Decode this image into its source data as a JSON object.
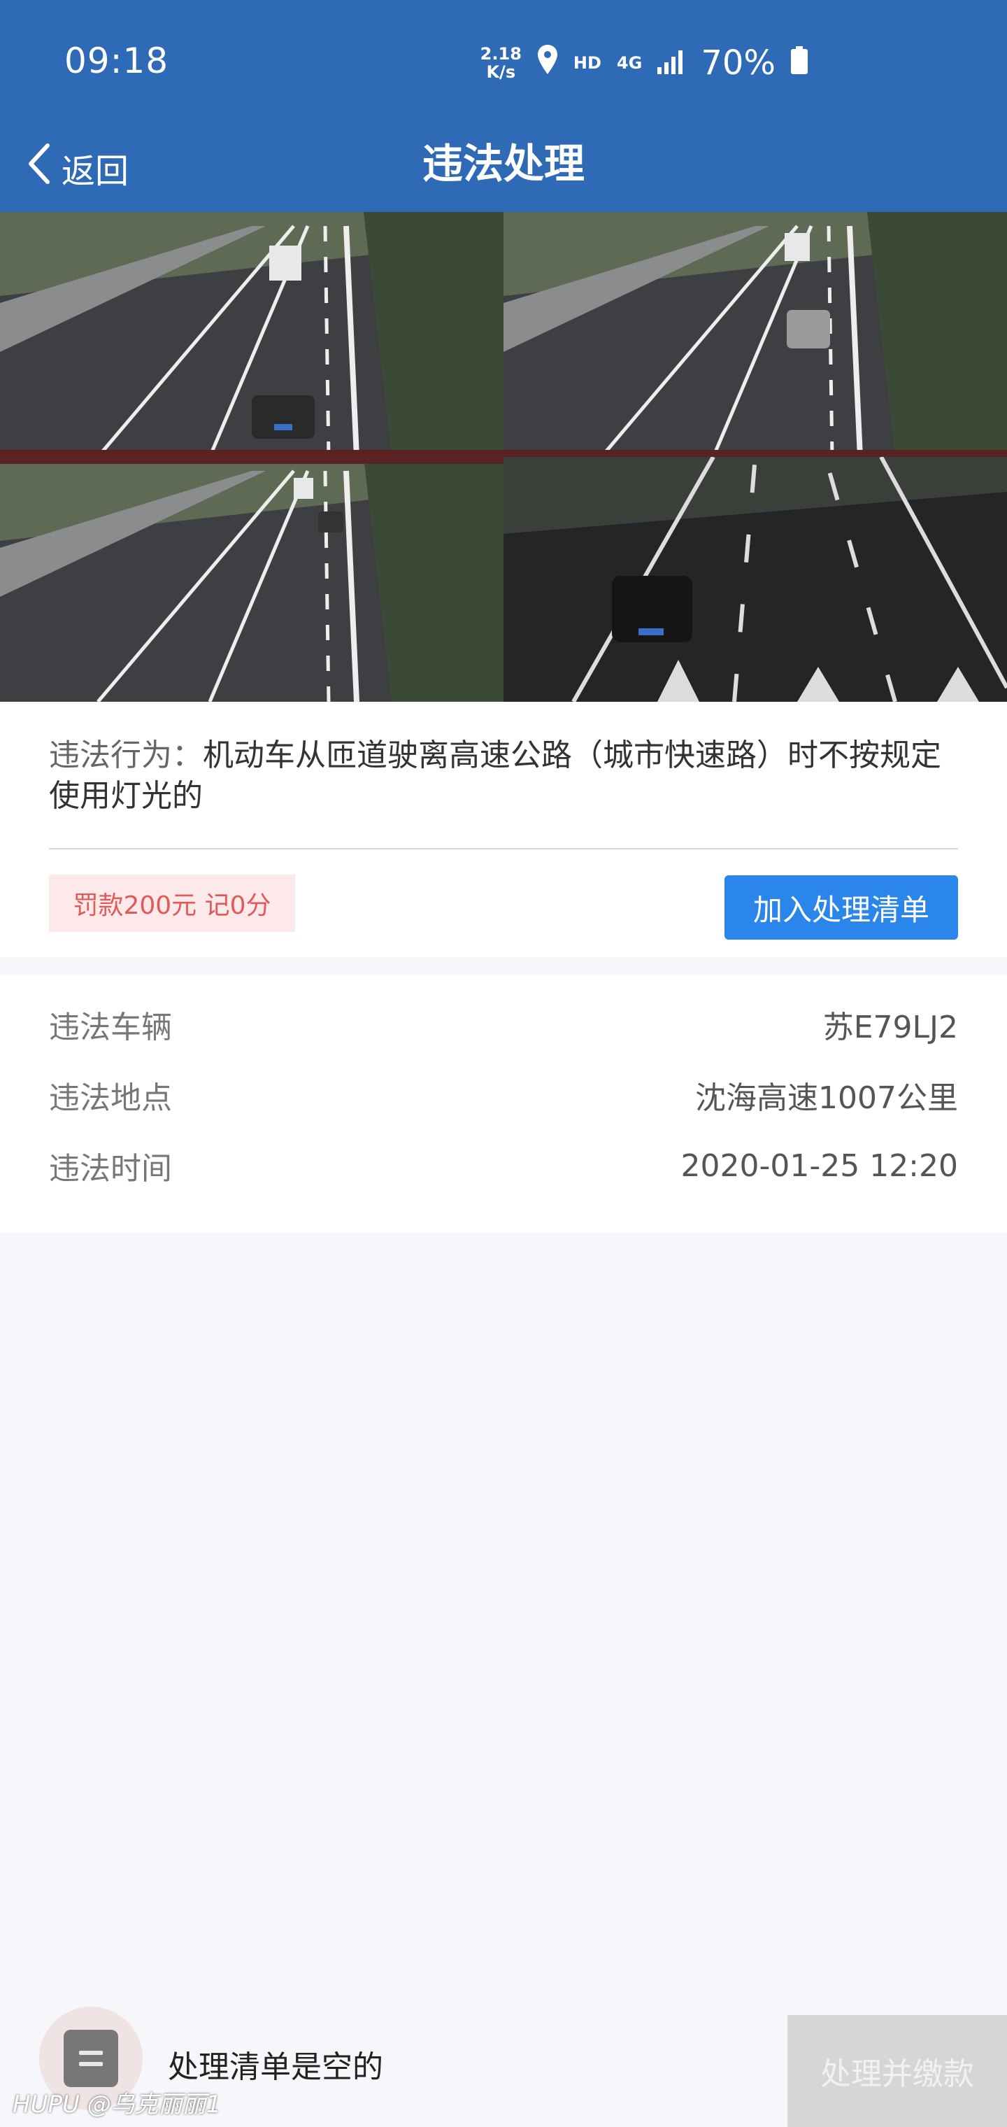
{
  "status_bar": {
    "time": "09:18",
    "net_speed_value": "2.18",
    "net_speed_unit": "K/s",
    "hd": "HD",
    "network": "4G",
    "battery": "70%",
    "icons": [
      "location-icon",
      "signal-icon",
      "battery-icon"
    ]
  },
  "nav": {
    "back_label": "返回",
    "title": "违法处理"
  },
  "photos": [
    {
      "name": "evidence-photo-1"
    },
    {
      "name": "evidence-photo-2"
    },
    {
      "name": "evidence-photo-3"
    },
    {
      "name": "evidence-photo-4"
    }
  ],
  "violation": {
    "behavior_label": "违法行为：",
    "behavior_text": "机动车从匝道驶离高速公路（城市快速路）时不按规定使用灯光的",
    "fine_tag": "罚款200元 记0分",
    "add_button": "加入处理清单"
  },
  "info": {
    "rows": [
      {
        "key": "违法车辆",
        "value": "苏E79LJ2"
      },
      {
        "key": "违法地点",
        "value": "沈海高速1007公里"
      },
      {
        "key": "违法时间",
        "value": "2020-01-25 12:20"
      }
    ]
  },
  "bottom": {
    "empty_text": "处理清单是空的",
    "pay_button": "处理并缴款"
  },
  "watermark": "HUPU @乌克丽丽1",
  "colors": {
    "header_bg": "#2f6ab7",
    "accent": "#2a86ea",
    "fine_bg": "#fde8ea",
    "fine_text": "#e05a5a",
    "disabled": "#d6d6d6"
  }
}
